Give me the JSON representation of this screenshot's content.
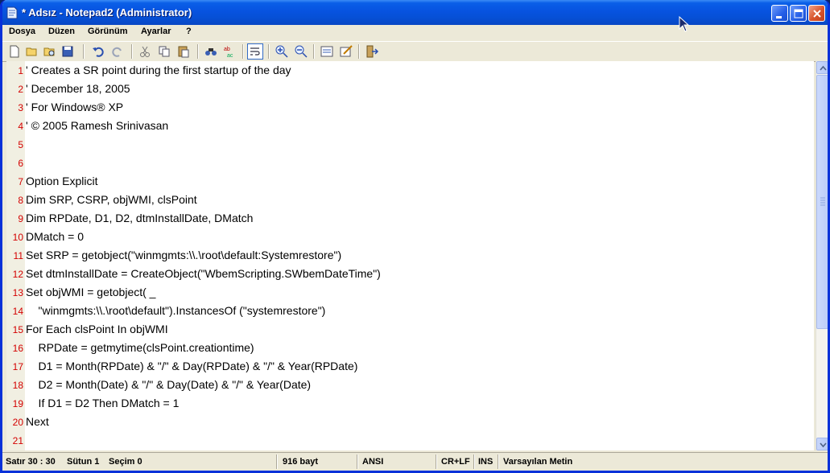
{
  "window": {
    "title": "* Adsız - Notepad2 (Administrator)"
  },
  "menu": [
    {
      "label": "Dosya"
    },
    {
      "label": "Düzen"
    },
    {
      "label": "Görünüm"
    },
    {
      "label": "Ayarlar"
    },
    {
      "label": "?"
    }
  ],
  "toolbar": {
    "icons": [
      "new-file-icon",
      "open-folder-icon",
      "browse-icon",
      "save-icon",
      "undo-icon",
      "redo-icon",
      "cut-icon",
      "copy-icon",
      "paste-icon",
      "find-icon",
      "replace-icon",
      "word-wrap-icon",
      "zoom-in-icon",
      "zoom-out-icon",
      "scheme-icon",
      "customize-icon",
      "exit-icon"
    ]
  },
  "editor": {
    "lines": [
      {
        "num": "1",
        "text": "' Creates a SR point during the first startup of the day"
      },
      {
        "num": "2",
        "text": "' December 18, 2005"
      },
      {
        "num": "3",
        "text": "' For Windows® XP"
      },
      {
        "num": "4",
        "text": "' © 2005 Ramesh Srinivasan"
      },
      {
        "num": "5",
        "text": ""
      },
      {
        "num": "6",
        "text": ""
      },
      {
        "num": "7",
        "text": "Option Explicit"
      },
      {
        "num": "8",
        "text": "Dim SRP, CSRP, objWMI, clsPoint"
      },
      {
        "num": "9",
        "text": "Dim RPDate, D1, D2, dtmInstallDate, DMatch"
      },
      {
        "num": "10",
        "text": "DMatch = 0"
      },
      {
        "num": "11",
        "text": "Set SRP = getobject(\"winmgmts:\\\\.\\root\\default:Systemrestore\")"
      },
      {
        "num": "12",
        "text": "Set dtmInstallDate = CreateObject(\"WbemScripting.SWbemDateTime\")"
      },
      {
        "num": "13",
        "text": "Set objWMI = getobject( _"
      },
      {
        "num": "14",
        "text": "    \"winmgmts:\\\\.\\root\\default\").InstancesOf (\"systemrestore\")"
      },
      {
        "num": "15",
        "text": "For Each clsPoint In objWMI"
      },
      {
        "num": "16",
        "text": "    RPDate = getmytime(clsPoint.creationtime)"
      },
      {
        "num": "17",
        "text": "    D1 = Month(RPDate) & \"/\" & Day(RPDate) & \"/\" & Year(RPDate)"
      },
      {
        "num": "18",
        "text": "    D2 = Month(Date) & \"/\" & Day(Date) & \"/\" & Year(Date)"
      },
      {
        "num": "19",
        "text": "    If D1 = D2 Then DMatch = 1"
      },
      {
        "num": "20",
        "text": "Next"
      },
      {
        "num": "21",
        "text": ""
      }
    ]
  },
  "status": {
    "position": "Satır 30 : 30",
    "column": "Sütun 1",
    "selection": "Seçim 0",
    "size": "916 bayt",
    "encoding": "ANSI",
    "line_ending": "CR+LF",
    "insert_mode": "INS",
    "scheme": "Varsayılan Metin"
  }
}
